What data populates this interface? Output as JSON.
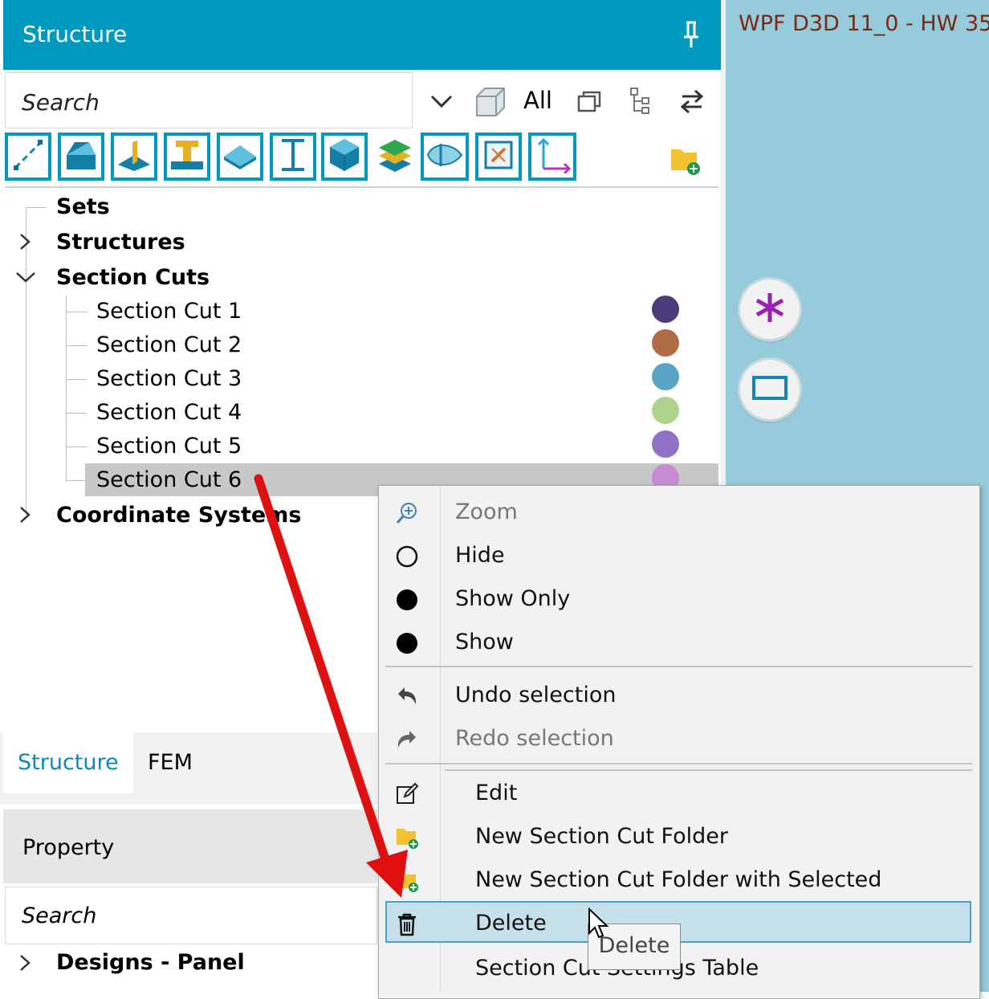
{
  "structure_panel": {
    "title": "Structure",
    "search_placeholder": "Search",
    "filter_label": "All",
    "icons": [
      "pin-icon",
      "chevron-down-icon",
      "box-icon",
      "copy-icon",
      "hierarchy-icon",
      "swap-icon",
      "new-folder-icon"
    ],
    "type_filters": [
      "line-icon",
      "solid-icon",
      "plate-icon",
      "beam-icon",
      "surface-icon",
      "i-beam-icon",
      "cube-icon",
      "layers-icon",
      "section-icon",
      "frame-icon",
      "axes-icon"
    ]
  },
  "tree": {
    "sets": "Sets",
    "structures": "Structures",
    "section_cuts": "Section Cuts",
    "coordinate_systems": "Coordinate Systems",
    "items": [
      {
        "label": "Section Cut 1",
        "color": "#4a3b7a"
      },
      {
        "label": "Section Cut 2",
        "color": "#b06d45"
      },
      {
        "label": "Section Cut 3",
        "color": "#5ba3c4"
      },
      {
        "label": "Section Cut 4",
        "color": "#aed38a"
      },
      {
        "label": "Section Cut 5",
        "color": "#8f72c8"
      },
      {
        "label": "Section Cut 6",
        "color": "#c98ad4"
      }
    ]
  },
  "bottom_tabs": {
    "structure": "Structure",
    "fem": "FEM",
    "property": "Property",
    "search_placeholder": "Search",
    "designs_panel": "Designs - Panel"
  },
  "viewport": {
    "title": "WPF D3D 11_0 - HW  35",
    "buttons": [
      "asterisk-icon",
      "rectangle-icon"
    ]
  },
  "context_menu": {
    "zoom": "Zoom",
    "hide": "Hide",
    "show_only": "Show Only",
    "show": "Show",
    "undo": "Undo selection",
    "redo": "Redo selection",
    "edit": "Edit",
    "new_folder": "New Section Cut Folder",
    "new_folder_selected": "New Section Cut Folder with Selected",
    "delete": "Delete",
    "settings_table": "Section Cut Settings Table"
  },
  "tooltip": "Delete",
  "colors": {
    "header": "#0099bf",
    "arrow": "#e01010",
    "selection": "#c8c8c8",
    "menu_highlight": "#c5e0ea"
  }
}
